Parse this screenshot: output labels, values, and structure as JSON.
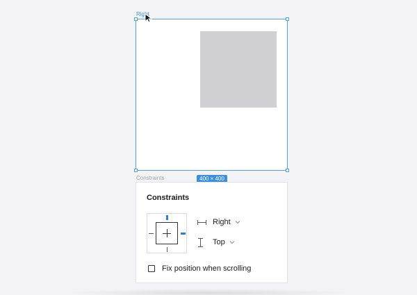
{
  "canvas": {
    "frame_label": "Right",
    "size_badge": "400 × 400",
    "section_caption": "Constraints"
  },
  "constraints_panel": {
    "title": "Constraints",
    "horizontal": {
      "value": "Right",
      "icon": "horizontal-constraint-icon"
    },
    "vertical": {
      "value": "Top",
      "icon": "vertical-constraint-icon"
    },
    "fix_position": {
      "label": "Fix position when scrolling",
      "checked": false
    },
    "widget_active": [
      "top",
      "right"
    ]
  },
  "colors": {
    "selection": "#4aa3e8",
    "accent": "#2b7fd6",
    "child_fill": "#d0cfd1",
    "background": "#f3f2f4"
  }
}
